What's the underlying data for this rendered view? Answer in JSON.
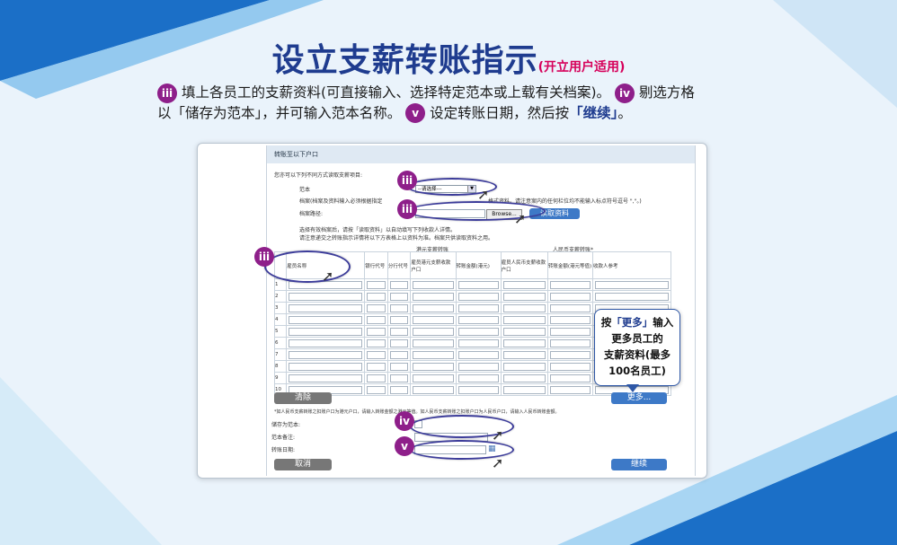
{
  "title": {
    "main": "设立支薪转账指示",
    "sub": "(开立用户适用)"
  },
  "instructions": {
    "badge_iii": "iii",
    "part1": "填上各员工的支薪资料(可直接输入、选择特定范本或上载有关档案)。",
    "badge_iv": "iv",
    "part2a": "剔选方格",
    "part2b": "以「储存为范本」，并可输入范本名称。",
    "badge_v": "v",
    "part3": "设定转账日期，然后按",
    "part3_hl": "「继续」",
    "part3_end": "。"
  },
  "form": {
    "header": "转账至以下户口",
    "intro": "您亦可以下列不同方式读取支薪项目:",
    "template_label": "范本",
    "template_value": "--请选择---",
    "file_note_a": "档案(档案及资料输入必须根据指定",
    "file_note_b": "格式资料。请注意案内的任何栏位均不能输入标点符号逗号 \",\"。)",
    "file_path_label": "档案路径:",
    "browse": "Browse...",
    "read_file": "读取资料",
    "note1": "选择有效档案后，请按「读取资料」以自动填写下列收款人详情。",
    "note2": "请注意递交之转账指示详情将以下方表格上以资料为准。档案只供读取资料之用。",
    "hk_group": "港元支薪转账",
    "rmb_group": "人民币支薪转账*",
    "columns": [
      "雇员名称",
      "银行代号",
      "分行代号",
      "雇员港元支薪收款户口",
      "转账金额(港元)",
      "雇员人民币支薪收款户口",
      "转账金额(港元等值)",
      "收款人参考"
    ],
    "rows": [
      "1",
      "2",
      "3",
      "4",
      "5",
      "6",
      "7",
      "8",
      "9",
      "10"
    ],
    "clear": "清除",
    "more": "更多...",
    "footnote": "*如人民币支薪转账之扣账户口为港元户口，请输入转账金额之港元等值。如人民币支薪转账之扣账户口为人民币户口，请输入人民币转账金额。",
    "save_template": "储存为范本:",
    "template_note": "范本备注:",
    "transfer_date": "转账日期:",
    "cancel": "取消",
    "continue": "继续"
  },
  "tooltip": {
    "line1a": "按",
    "line1_hl": "「更多」",
    "line1b": "输入",
    "line2": "更多员工的",
    "line3": "支薪资料(最多",
    "line4": "100名员工)"
  },
  "markers": {
    "iii": "iii",
    "iv": "iv",
    "v": "v"
  },
  "colors": {
    "title": "#1f3c8f",
    "badge": "#8e1f8a",
    "accent": "#d6005a",
    "button": "#3d79c7"
  }
}
